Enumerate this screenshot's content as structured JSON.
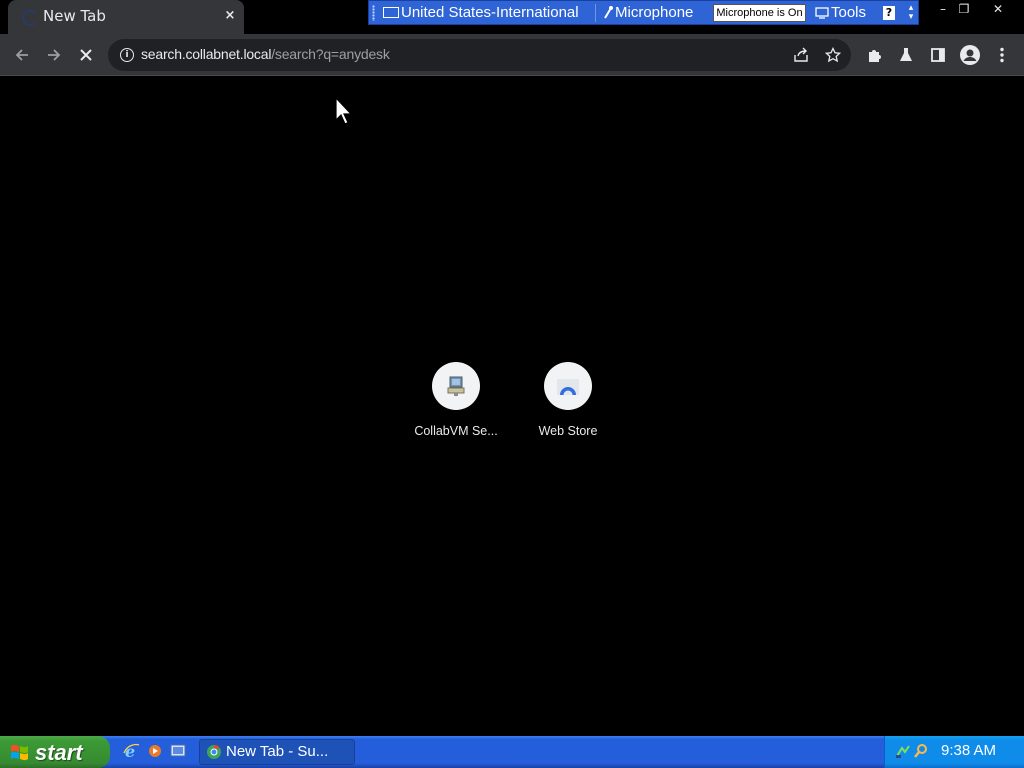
{
  "tab": {
    "title": "New Tab",
    "close": "×"
  },
  "language_bar": {
    "keyboard": "United States-International",
    "microphone": "Microphone",
    "mic_status": "Microphone is On",
    "tools": "Tools",
    "help": "?"
  },
  "window_controls": {
    "minimize": "–",
    "restore": "❐",
    "close": "✕"
  },
  "toolbar": {
    "url_host": "search.collabnet.local",
    "url_path": "/search?q=anydesk"
  },
  "shortcuts": [
    {
      "label": "CollabVM Se..."
    },
    {
      "label": "Web Store"
    }
  ],
  "taskbar": {
    "start_label": "start",
    "task_label": "New Tab - Su...",
    "clock": "9:38 AM"
  }
}
